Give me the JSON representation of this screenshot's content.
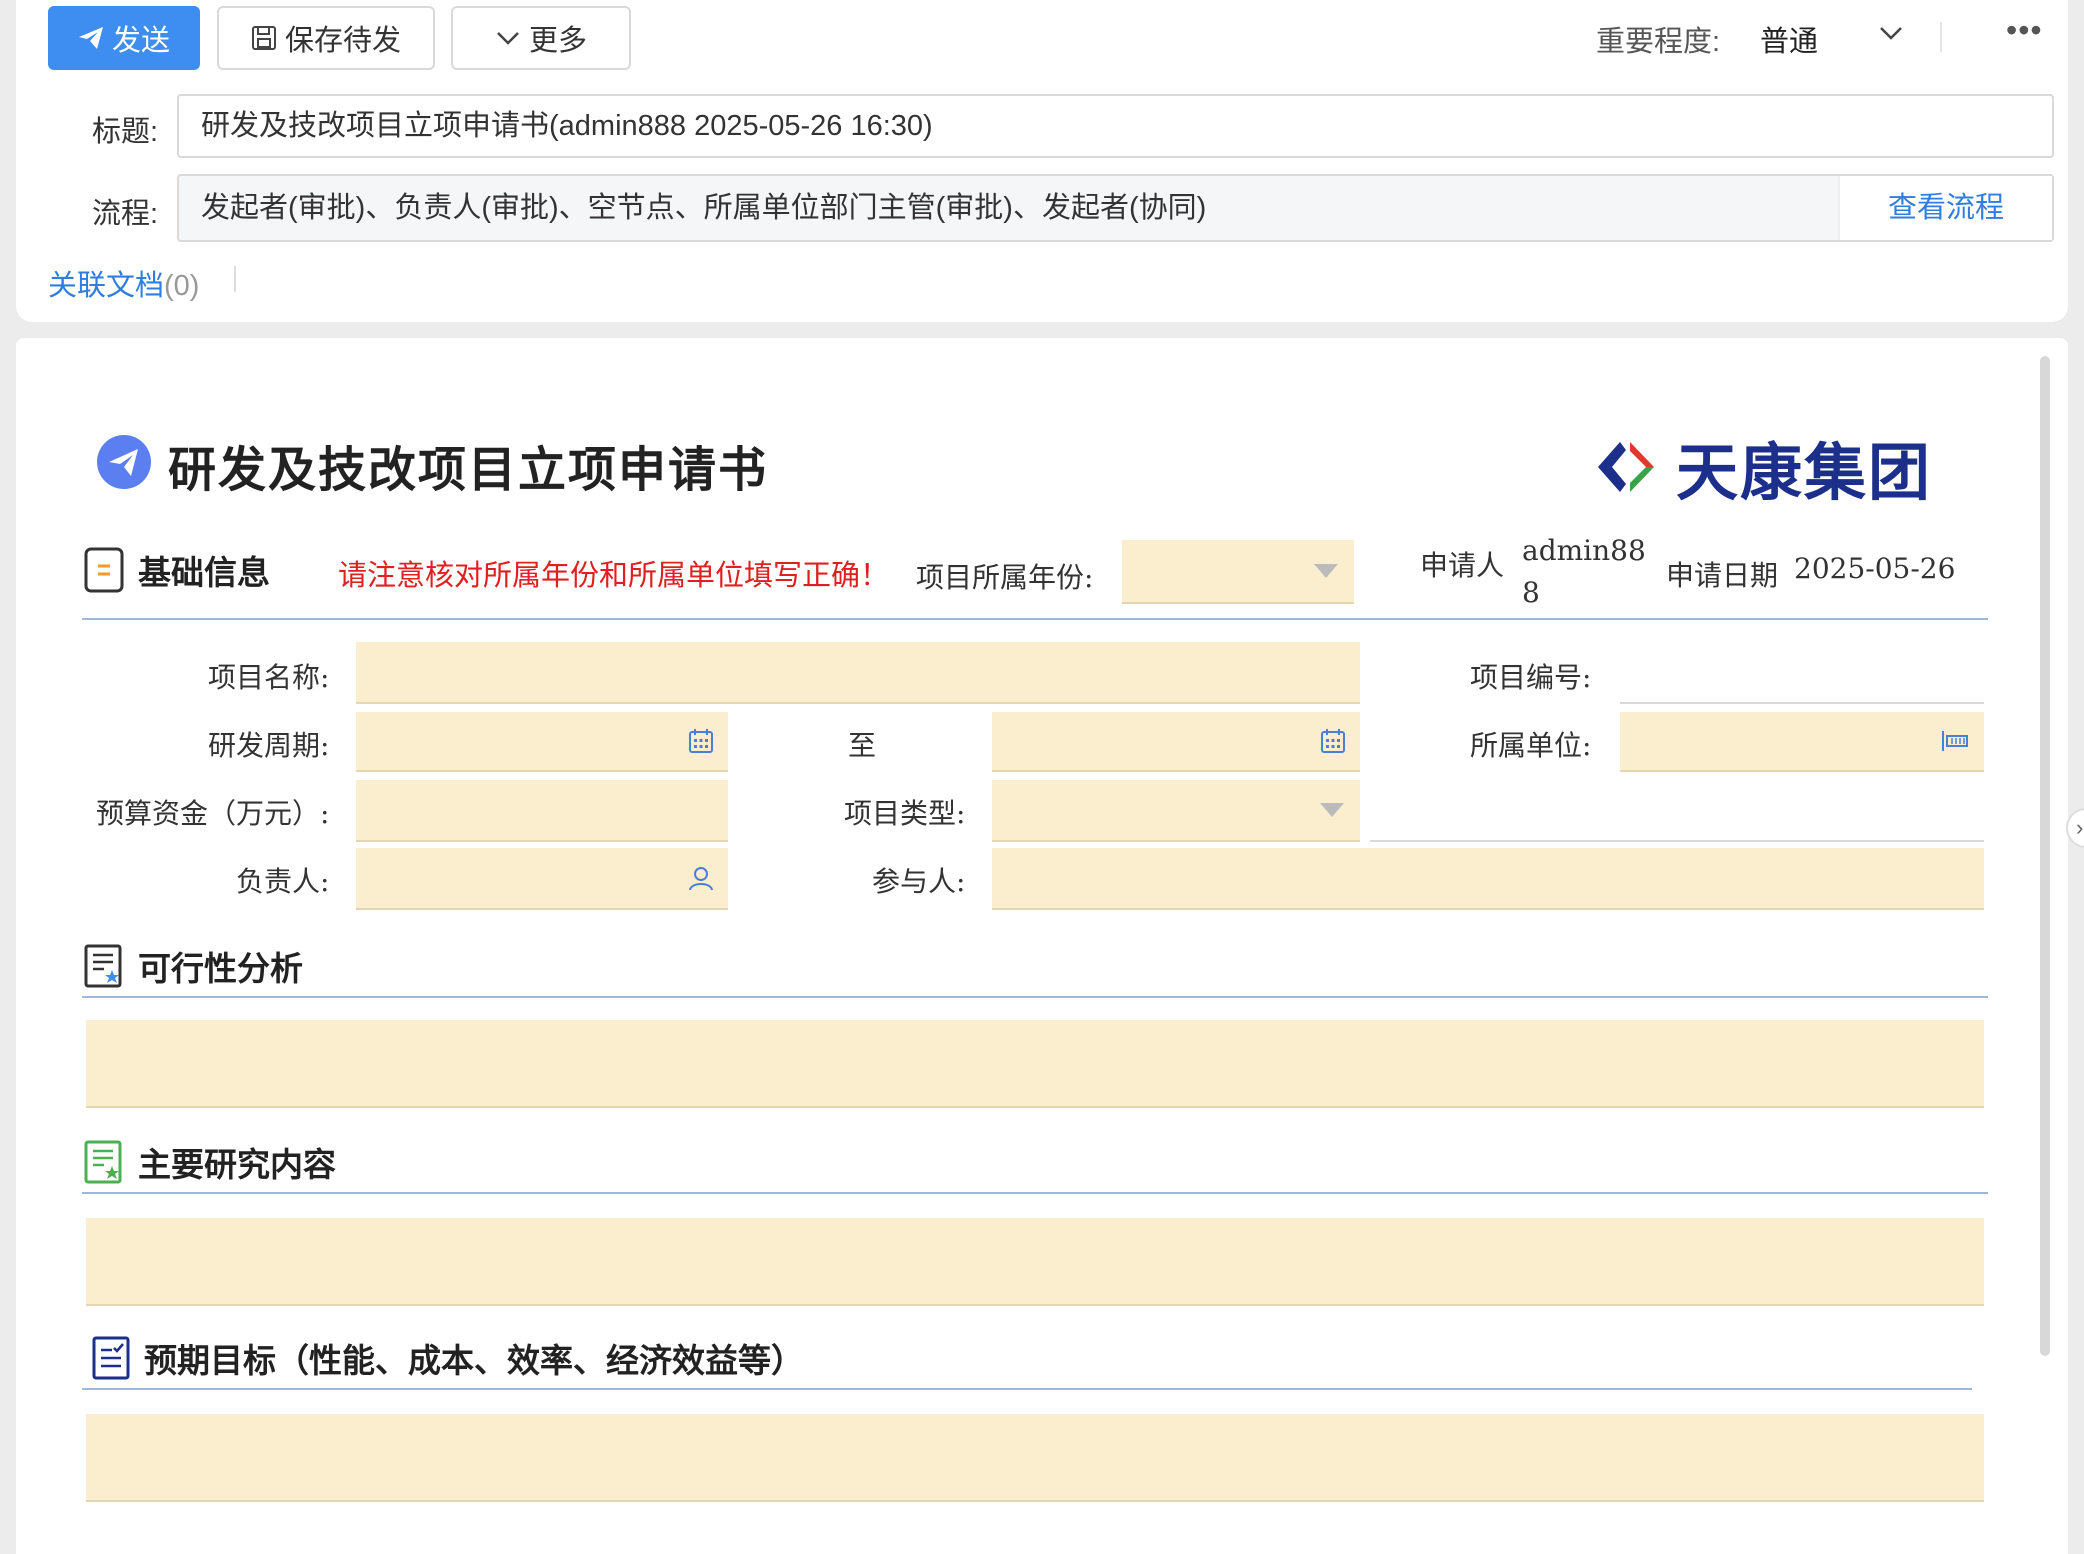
{
  "toolbar": {
    "send_label": "发送",
    "save_label": "保存待发",
    "more_label": "更多",
    "importance_label": "重要程度:",
    "importance_value": "普通",
    "overflow": "•••"
  },
  "header": {
    "title_label": "标题:",
    "title_value": "研发及技改项目立项申请书(admin888 2025-05-26 16:30)",
    "flow_label": "流程:",
    "flow_value": "发起者(审批)、负责人(审批)、空节点、所属单位部门主管(审批)、发起者(协同)",
    "view_flow": "查看流程",
    "related_docs_label": "关联文档",
    "related_docs_count": "(0)"
  },
  "form": {
    "title": "研发及技改项目立项申请书",
    "brand": "天康集团",
    "basic": {
      "section_title": "基础信息",
      "warning": "请注意核对所属年份和所属单位填写正确！",
      "year_label": "项目所属年份:",
      "applicant_label": "申请人",
      "applicant_value_1": "admin88",
      "applicant_value_2": "8",
      "date_label": "申请日期",
      "date_value": "2025-05-26",
      "project_name_label": "项目名称:",
      "project_no_label": "项目编号:",
      "period_label": "研发周期:",
      "to_label": "至",
      "unit_label": "所属单位:",
      "budget_label": "预算资金（万元）:",
      "type_label": "项目类型:",
      "owner_label": "负责人:",
      "participants_label": "参与人:"
    },
    "feasibility": {
      "section_title": "可行性分析"
    },
    "research": {
      "section_title": "主要研究内容"
    },
    "goals": {
      "section_title": "预期目标（性能、成本、效率、经济效益等）"
    }
  },
  "colors": {
    "primary": "#3d8ef0",
    "link": "#2f7de1",
    "warning": "#e02020",
    "field_bg": "#fbeecf",
    "brand": "#1c2f8a"
  }
}
